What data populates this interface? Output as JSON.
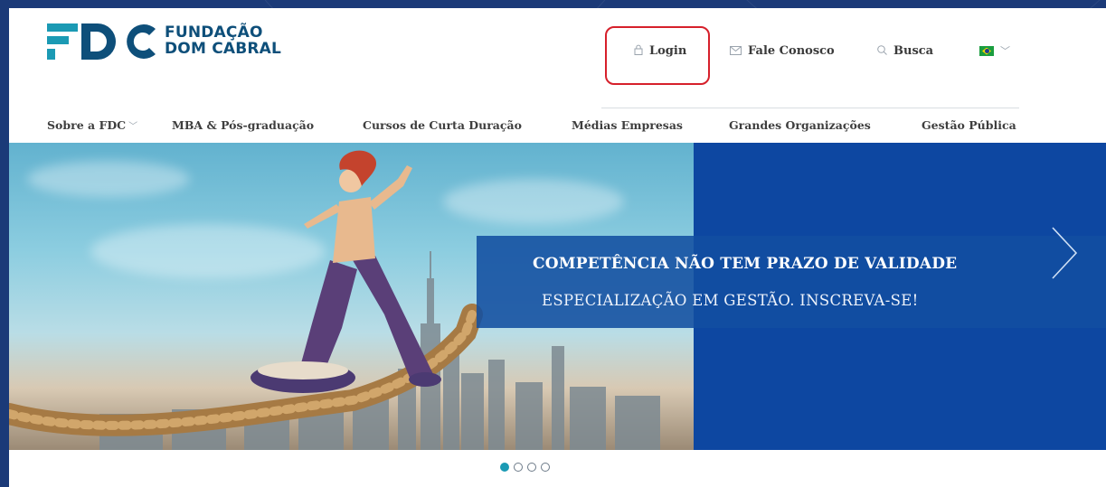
{
  "logo": {
    "brand": "FDC",
    "line1": "FUNDAÇÃO",
    "line2": "DOM CABRAL"
  },
  "top_links": {
    "login": "Login",
    "contact": "Fale Conosco",
    "search": "Busca"
  },
  "icons": {
    "login": "lock-icon",
    "contact": "envelope-icon",
    "search": "search-icon",
    "language": "brazil-flag-icon"
  },
  "nav": {
    "items": [
      "Sobre a FDC",
      "MBA & Pós-graduação",
      "Cursos de Curta Duração",
      "Médias Empresas",
      "Grandes Organizações",
      "Gestão Pública"
    ]
  },
  "hero": {
    "title": "COMPETÊNCIA NÃO TEM PRAZO DE VALIDADE",
    "subtitle": "ESPECIALIZAÇÃO EM GESTÃO. INSCREVA-SE!",
    "slides_total": 4,
    "active_slide": 1
  },
  "colors": {
    "brand_teal": "#1b9ab4",
    "brand_navy": "#0e4f7a",
    "hero_blue": "#0d47a1",
    "highlight_red": "#d6202b"
  }
}
